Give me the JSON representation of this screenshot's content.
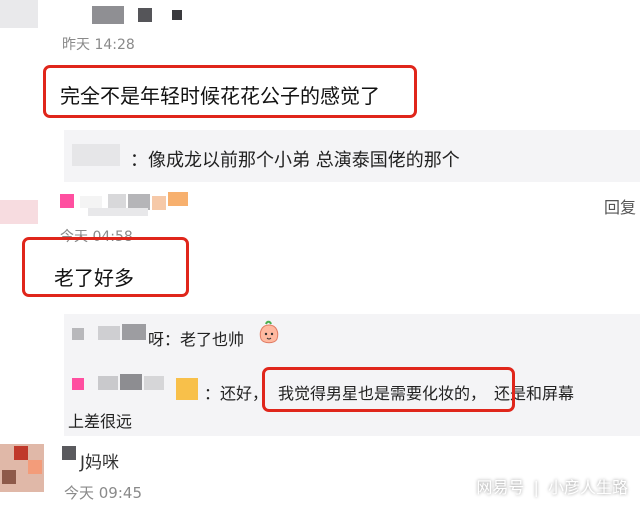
{
  "comment1": {
    "time": "昨天 14:28",
    "text": "完全不是年轻时候花花公子的感觉了"
  },
  "quote1": {
    "prefix": "：",
    "text": "像成龙以前那个小弟 总演泰国佬的那个"
  },
  "comment2": {
    "reply_label": "回复",
    "time": "今天 04:58",
    "text": "老了好多"
  },
  "reply1": {
    "name_tail": "呀",
    "text": "：老了也帅",
    "emoji": "peach-face-emoji"
  },
  "reply2": {
    "prefix": "：还好，",
    "highlight": "我觉得男星也是需要化妆的，",
    "suffix": "还是和屏幕",
    "line2": "上差很远"
  },
  "comment3": {
    "name_tail": "J妈咪",
    "time": "今天 09:45"
  },
  "watermark": {
    "source": "网易号",
    "separator": "|",
    "author": "小彦人生路"
  },
  "colors": {
    "highlight_border": "#e0261b",
    "timestamp": "#8a8a8a"
  }
}
